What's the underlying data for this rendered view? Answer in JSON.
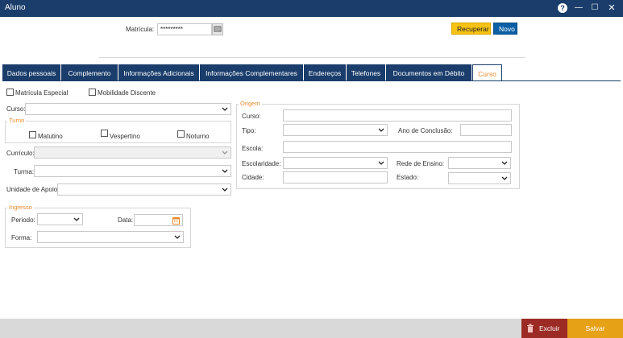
{
  "window": {
    "title": "Aluno",
    "help": "?",
    "minimize": "—",
    "maximize": "☐",
    "close": "✕"
  },
  "header": {
    "matricula_label": "Matrícula:",
    "matricula_value": "*********",
    "recuperar_label": "Recuperar",
    "novo_label": "Novo"
  },
  "tabs": [
    "Dados pessoais",
    "Complemento",
    "Informações Adicionais",
    "Informações Complementares",
    "Endereços",
    "Telefones",
    "Documentos em Débito",
    "Curso"
  ],
  "active_tab": "Curso",
  "curso": {
    "matricula_especial": "Matrícula Especial",
    "mobilidade_discente": "Mobilidade Discente",
    "curso_label": "Curso:",
    "turno_legend": "Turno",
    "matutino": "Matutino",
    "vespertino": "Vespertino",
    "noturno": "Noturno",
    "curriculo_label": "Currículo:",
    "turma_label": "Turma:",
    "unidade_apoio_label": "Unidade de Apoio:",
    "ingresso_legend": "Ingresso",
    "periodo_label": "Periodo:",
    "data_label": "Data:",
    "forma_label": "Forma:"
  },
  "origem": {
    "legend": "Origem",
    "curso_label": "Curso:",
    "tipo_label": "Tipo:",
    "ano_conclusao_label": "Ano de Conclusão:",
    "escola_label": "Escola:",
    "escolaridade_label": "Escolaridade:",
    "rede_ensino_label": "Rede de Ensino:",
    "cidade_label": "Cidade:",
    "estado_label": "Estado:"
  },
  "footer": {
    "excluir_label": "Excluir",
    "salvar_label": "Salvar"
  },
  "colors": {
    "titlebar": "#1a3d6b",
    "accent_orange": "#e8892b",
    "recuperar": "#f7c212",
    "novo": "#0b5fa5",
    "excluir": "#9b2b24",
    "salvar": "#e6a116"
  }
}
